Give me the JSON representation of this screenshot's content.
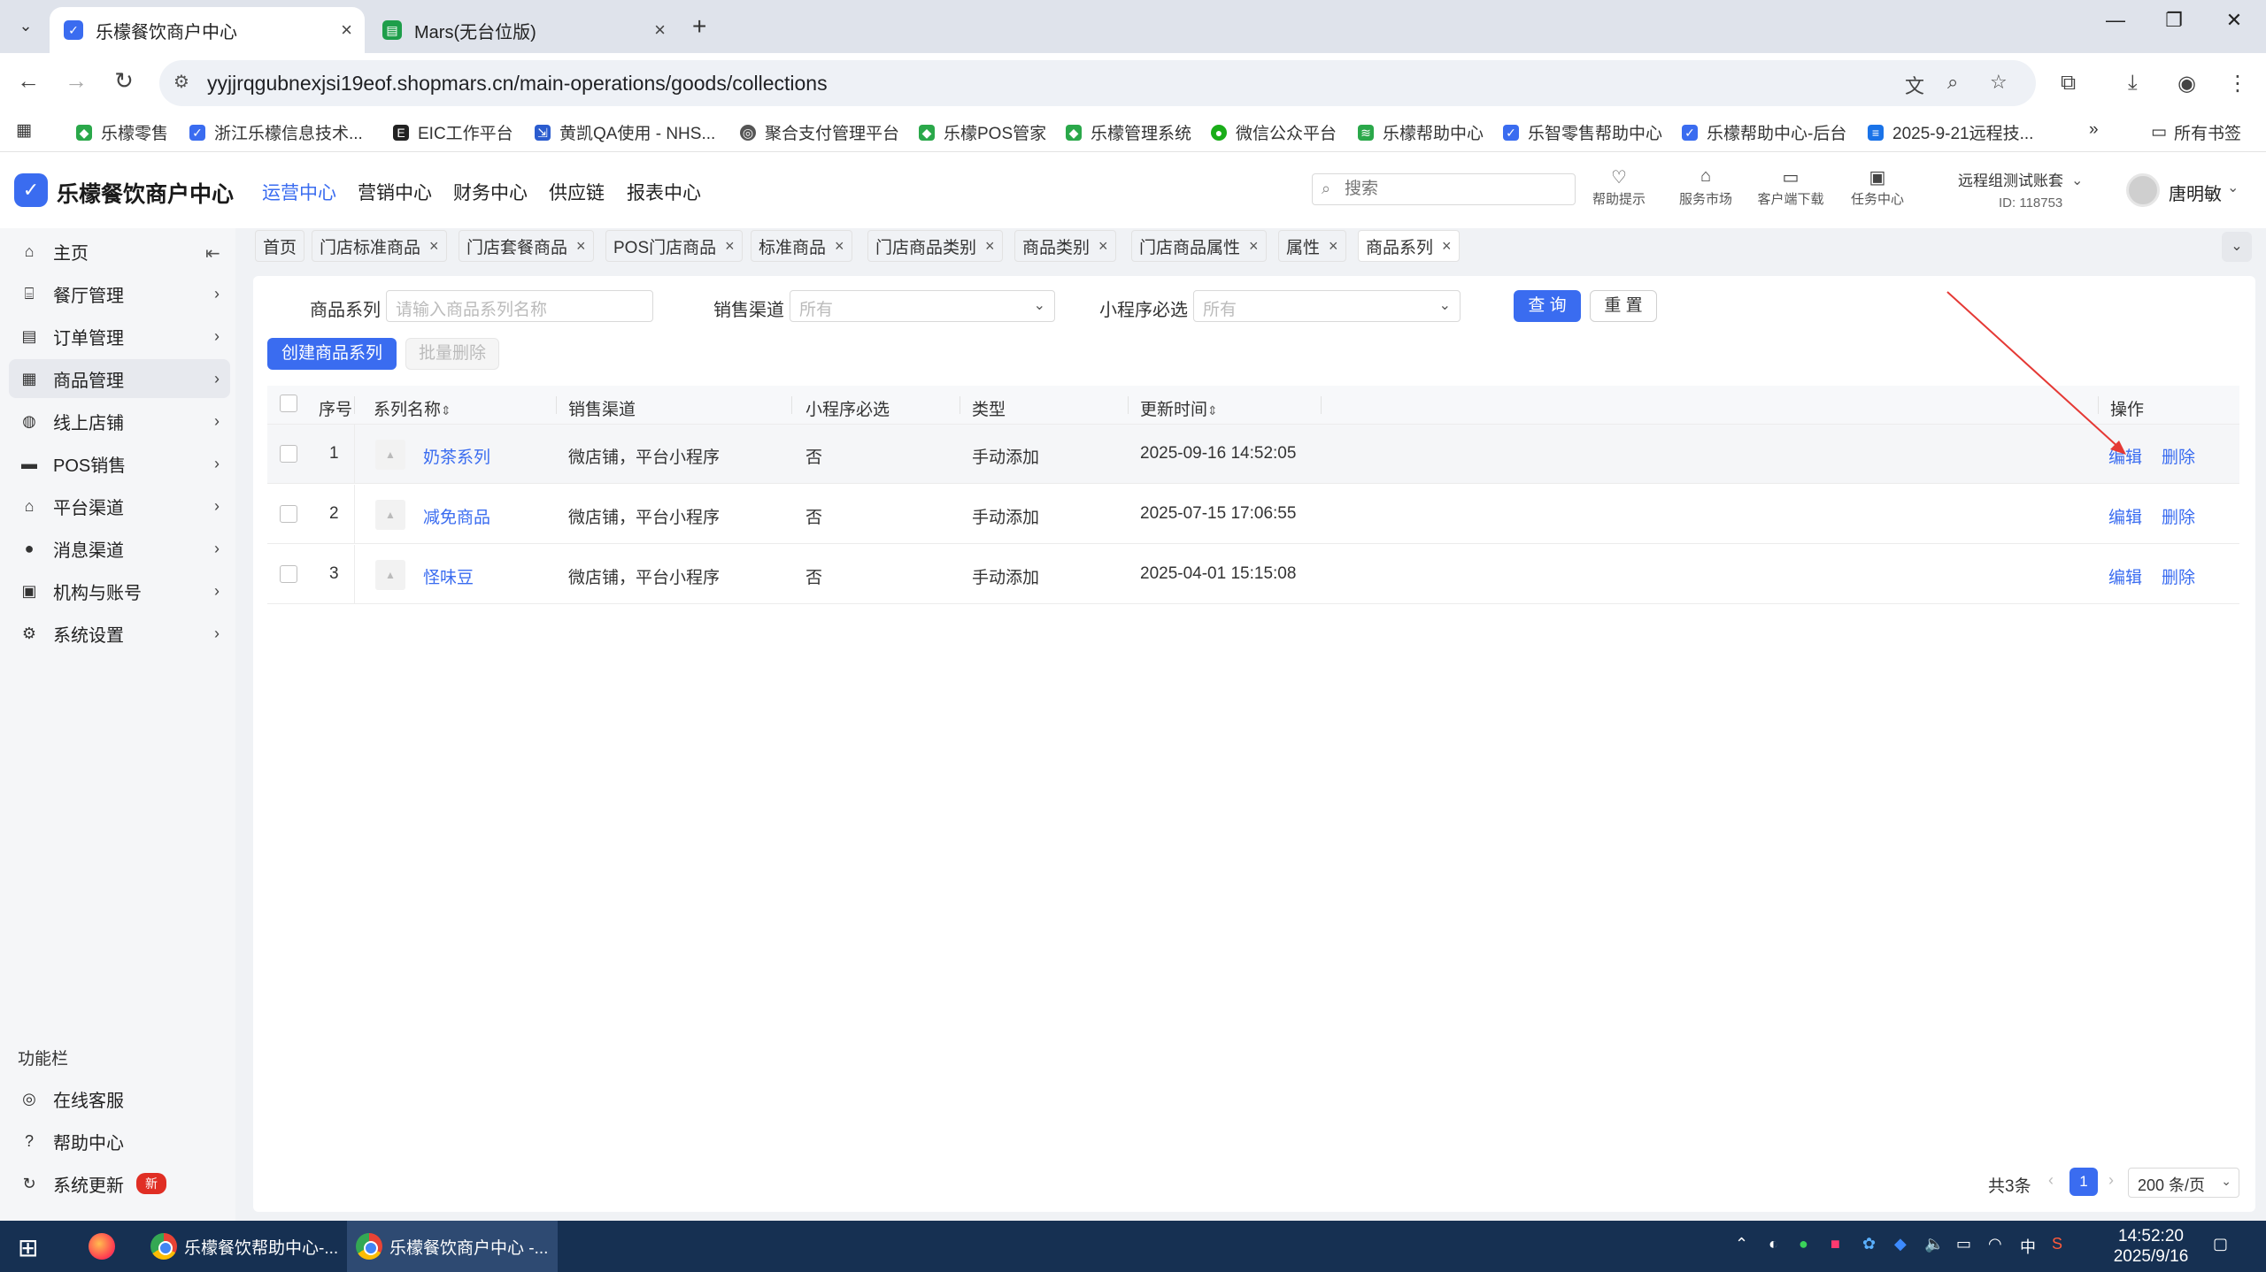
{
  "browser": {
    "tabs": [
      {
        "title": "乐檬餐饮商户中心",
        "active": true
      },
      {
        "title": "Mars(无台位版)",
        "active": false
      }
    ],
    "url": "yyjjrqgubnexjsi19eof.shopmars.cn/main-operations/goods/collections",
    "bookmarks": [
      "乐檬零售",
      "浙江乐檬信息技术...",
      "EIC工作平台",
      "黄凯QA使用 - NHS...",
      "聚合支付管理平台",
      "乐檬POS管家",
      "乐檬管理系统",
      "微信公众平台",
      "乐檬帮助中心",
      "乐智零售帮助中心",
      "乐檬帮助中心-后台",
      "2025-9-21远程技..."
    ],
    "bookmarks_more": "»",
    "all_bookmarks": "所有书签"
  },
  "app": {
    "brand": "乐檬餐饮商户中心",
    "top_nav": [
      "运营中心",
      "营销中心",
      "财务中心",
      "供应链",
      "报表中心"
    ],
    "active_nav": "运营中心",
    "search_placeholder": "搜索",
    "header_icons": [
      {
        "label": "帮助提示",
        "icon": "bulb-icon"
      },
      {
        "label": "服务市场",
        "icon": "shop-icon"
      },
      {
        "label": "客户端下载",
        "icon": "folder-icon"
      },
      {
        "label": "任务中心",
        "icon": "clipboard-icon"
      }
    ],
    "account_name": "远程组测试账套",
    "account_id": "ID: 118753",
    "user_name": "唐明敏"
  },
  "sidebar": {
    "items": [
      {
        "label": "主页",
        "icon": "home-icon"
      },
      {
        "label": "餐厅管理",
        "icon": "store-icon"
      },
      {
        "label": "订单管理",
        "icon": "order-icon"
      },
      {
        "label": "商品管理",
        "icon": "goods-icon",
        "active": true
      },
      {
        "label": "线上店铺",
        "icon": "globe-icon"
      },
      {
        "label": "POS销售",
        "icon": "pos-icon"
      },
      {
        "label": "平台渠道",
        "icon": "bank-icon"
      },
      {
        "label": "消息渠道",
        "icon": "chat-icon"
      },
      {
        "label": "机构与账号",
        "icon": "org-icon"
      },
      {
        "label": "系统设置",
        "icon": "gear-icon"
      }
    ],
    "function_title": "功能栏",
    "functions": [
      {
        "label": "在线客服",
        "icon": "headset-icon"
      },
      {
        "label": "帮助中心",
        "icon": "help-icon"
      },
      {
        "label": "系统更新",
        "icon": "refresh-icon",
        "badge": "新"
      }
    ]
  },
  "page_tabs": [
    "首页",
    "门店标准商品",
    "门店套餐商品",
    "POS门店商品",
    "标准商品",
    "门店商品类别",
    "商品类别",
    "门店商品属性",
    "属性",
    "商品系列"
  ],
  "filters": {
    "series_label": "商品系列",
    "series_placeholder": "请输入商品系列名称",
    "channel_label": "销售渠道",
    "channel_value": "所有",
    "required_label": "小程序必选",
    "required_value": "所有",
    "query_btn": "查 询",
    "reset_btn": "重 置",
    "create_btn": "创建商品系列",
    "batch_delete_btn": "批量删除"
  },
  "table": {
    "columns": [
      "序号",
      "系列名称",
      "销售渠道",
      "小程序必选",
      "类型",
      "更新时间",
      "操作"
    ],
    "rows": [
      {
        "no": "1",
        "name": "奶茶系列",
        "channel": "微店铺，平台小程序",
        "required": "否",
        "type": "手动添加",
        "updated": "2025-09-16 14:52:05"
      },
      {
        "no": "2",
        "name": "减免商品",
        "channel": "微店铺，平台小程序",
        "required": "否",
        "type": "手动添加",
        "updated": "2025-07-15 17:06:55"
      },
      {
        "no": "3",
        "name": "怪味豆",
        "channel": "微店铺，平台小程序",
        "required": "否",
        "type": "手动添加",
        "updated": "2025-04-01 15:15:08"
      }
    ],
    "edit_label": "编辑",
    "delete_label": "删除"
  },
  "pager": {
    "total": "共3条",
    "current": "1",
    "page_size": "200 条/页"
  },
  "taskbar": {
    "apps": [
      "乐檬餐饮帮助中心-...",
      "乐檬餐饮商户中心 -..."
    ],
    "ime": "中",
    "time": "14:52:20",
    "date": "2025/9/16"
  }
}
